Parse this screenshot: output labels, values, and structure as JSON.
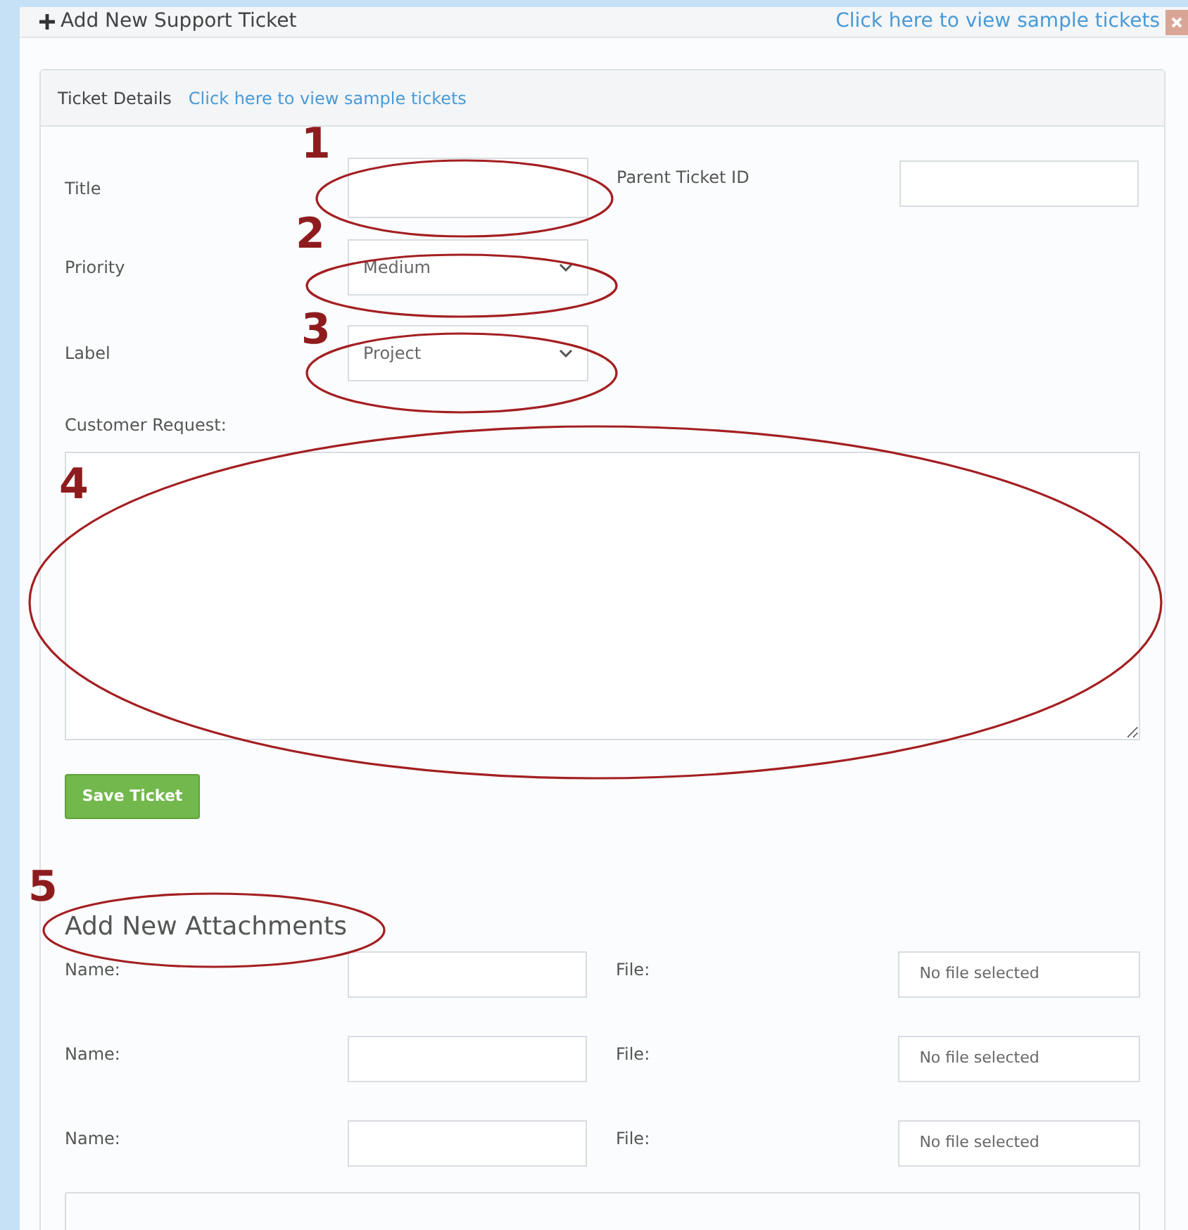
{
  "header": {
    "title": "Add New Support Ticket",
    "link": "Click here to view sample tickets"
  },
  "card": {
    "title": "Ticket Details",
    "link": "Click here to view sample tickets"
  },
  "form": {
    "title_label": "Title",
    "parent_label": "Parent Ticket ID",
    "priority_label": "Priority",
    "priority_value": "Medium",
    "label_label": "Label",
    "label_value": "Project",
    "request_label": "Customer Request:",
    "save_button": "Save Ticket"
  },
  "attachments": {
    "heading": "Add New Attachments",
    "rows": [
      {
        "name_label": "Name:",
        "file_label": "File:",
        "file_status": "No file selected"
      },
      {
        "name_label": "Name:",
        "file_label": "File:",
        "file_status": "No file selected"
      },
      {
        "name_label": "Name:",
        "file_label": "File:",
        "file_status": "No file selected"
      }
    ]
  },
  "callouts": [
    "1",
    "2",
    "3",
    "4",
    "5"
  ]
}
